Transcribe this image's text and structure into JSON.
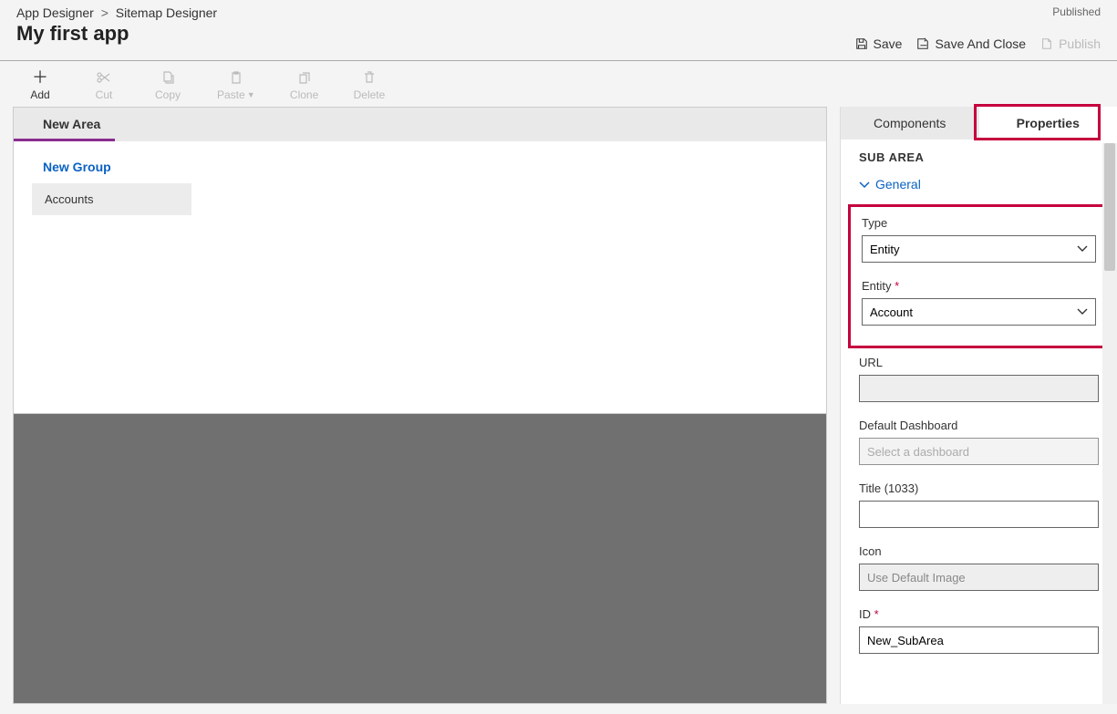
{
  "breadcrumb": {
    "app_designer": "App Designer",
    "sitemap_designer": "Sitemap Designer"
  },
  "header": {
    "title": "My first app",
    "status": "Published",
    "save": "Save",
    "save_close": "Save And Close",
    "publish": "Publish"
  },
  "toolbar": {
    "add": "Add",
    "cut": "Cut",
    "copy": "Copy",
    "paste": "Paste",
    "clone": "Clone",
    "delete": "Delete"
  },
  "sitemap": {
    "area": "New Area",
    "group": "New Group",
    "subarea": "Accounts"
  },
  "panel": {
    "tabs": {
      "components": "Components",
      "properties": "Properties"
    },
    "section": "SUB AREA",
    "accordion": "General",
    "type_label": "Type",
    "type_value": "Entity",
    "entity_label": "Entity",
    "entity_value": "Account",
    "url_label": "URL",
    "url_value": "",
    "dashboard_label": "Default Dashboard",
    "dashboard_placeholder": "Select a dashboard",
    "title_label": "Title (1033)",
    "title_value": "",
    "icon_label": "Icon",
    "icon_value": "Use Default Image",
    "id_label": "ID",
    "id_value": "New_SubArea"
  }
}
